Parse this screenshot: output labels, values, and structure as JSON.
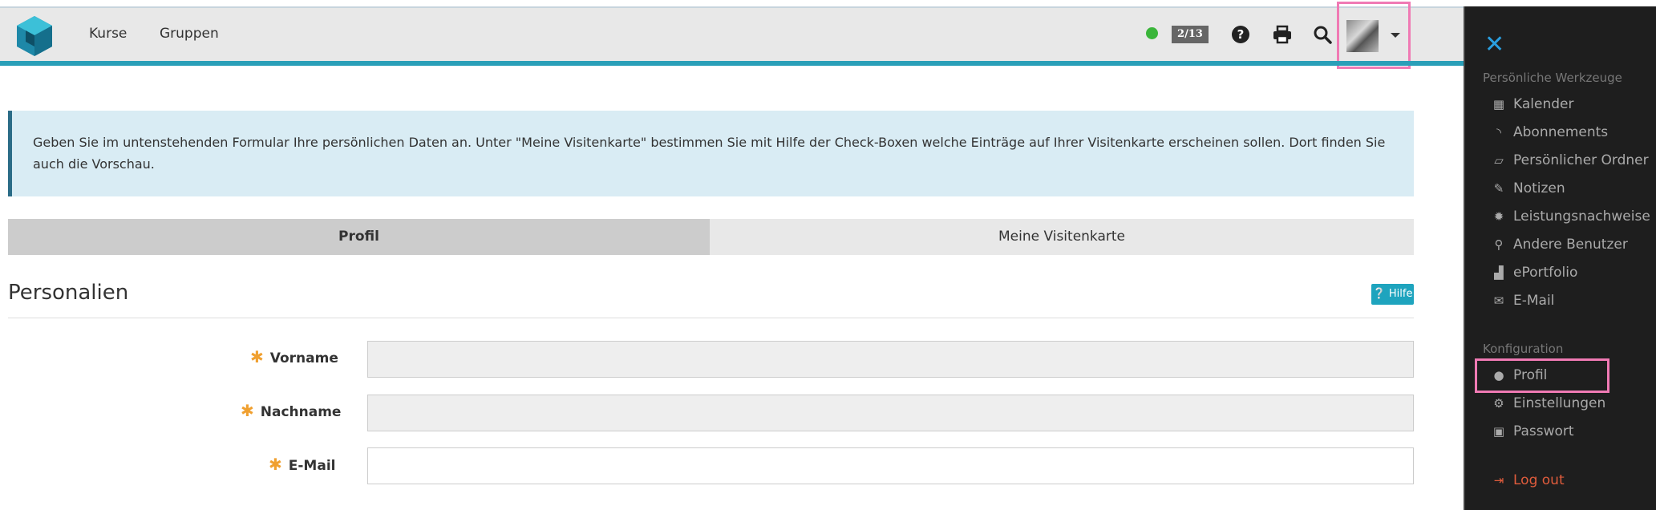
{
  "nav": {
    "kurse": "Kurse",
    "gruppen": "Gruppen"
  },
  "toolbar": {
    "counter": "2/13"
  },
  "info": {
    "text": "Geben Sie im untenstehenden Formular Ihre persönlichen Daten an. Unter \"Meine Visitenkarte\" bestimmen Sie mit Hilfe der Check-Boxen welche Einträge auf Ihrer Visitenkarte erscheinen sollen. Dort finden Sie auch die Vorschau."
  },
  "tabs": {
    "profil": "Profil",
    "visitenkarte": "Meine Visitenkarte"
  },
  "section": {
    "title": "Personalien",
    "help": "Hilfe"
  },
  "form": {
    "vorname_label": "Vorname",
    "nachname_label": "Nachname",
    "email_label": "E-Mail",
    "vorname_value": "",
    "nachname_value": "",
    "email_value": ""
  },
  "sidebar": {
    "heading_tools": "Persönliche Werkzeuge",
    "heading_config": "Konfiguration",
    "items": {
      "kalender": "Kalender",
      "abonnements": "Abonnements",
      "ordner": "Persönlicher Ordner",
      "notizen": "Notizen",
      "leistungsnachweise": "Leistungsnachweise",
      "benutzer": "Andere Benutzer",
      "eportfolio": "ePortfolio",
      "email": "E-Mail",
      "profil": "Profil",
      "einstellungen": "Einstellungen",
      "passwort": "Passwort",
      "logout": "Log out"
    }
  },
  "colors": {
    "accent": "#2a9fb8",
    "highlight": "#f07ab4",
    "status_online": "#3ab53a",
    "logout": "#e05c3c"
  }
}
